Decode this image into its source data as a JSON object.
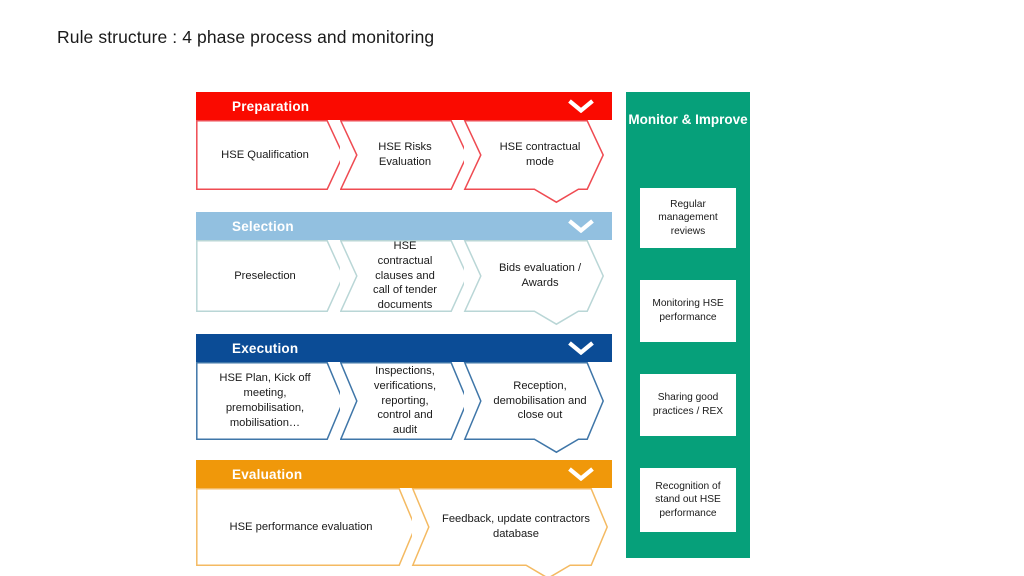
{
  "page": {
    "title": "Rule structure : 4 phase process and monitoring",
    "background": "#ffffff"
  },
  "colors": {
    "preparation": "#fa0a00",
    "preparation_border": "#ef4b52",
    "selection": "#92c0e0",
    "selection_border": "#b9d6d6",
    "execution": "#0b4c96",
    "execution_border": "#3f76a8",
    "evaluation": "#f0980a",
    "evaluation_border": "#f4ba62",
    "monitor": "#06a07a",
    "header_text": "#ffffff",
    "body_text": "#1a1a1a"
  },
  "process": {
    "phases": [
      {
        "id": "preparation",
        "label": "Preparation",
        "color": "#fa0a00",
        "border": "#ef4b52",
        "chevron_icon": "chevron-down-icon",
        "steps": [
          {
            "label": "HSE Qualification"
          },
          {
            "label": "HSE Risks Evaluation"
          },
          {
            "label": "HSE contractual mode"
          }
        ]
      },
      {
        "id": "selection",
        "label": "Selection",
        "color": "#92c0e0",
        "border": "#b9d6d6",
        "chevron_icon": "chevron-down-icon",
        "steps": [
          {
            "label": "Preselection"
          },
          {
            "label": "HSE contractual clauses and call of tender documents"
          },
          {
            "label": "Bids evaluation / Awards"
          }
        ]
      },
      {
        "id": "execution",
        "label": "Execution",
        "color": "#0b4c96",
        "border": "#3f76a8",
        "chevron_icon": "chevron-down-icon",
        "steps": [
          {
            "label": "HSE Plan, Kick off meeting, premobilisation, mobilisation…"
          },
          {
            "label": "Inspections, verifications, reporting, control and audit"
          },
          {
            "label": "Reception, demobilisation and close out"
          }
        ]
      },
      {
        "id": "evaluation",
        "label": "Evaluation",
        "color": "#f0980a",
        "border": "#f4ba62",
        "chevron_icon": "chevron-down-icon",
        "steps": [
          {
            "label": "HSE performance evaluation"
          },
          {
            "label": "Feedback, update contractors database"
          }
        ]
      }
    ]
  },
  "monitor": {
    "title": "Monitor & Improve",
    "color": "#06a07a",
    "cards": [
      {
        "label": "Regular management reviews"
      },
      {
        "label": "Monitoring HSE performance"
      },
      {
        "label": "Sharing good practices / REX"
      },
      {
        "label": "Recognition of stand out HSE performance"
      }
    ]
  }
}
